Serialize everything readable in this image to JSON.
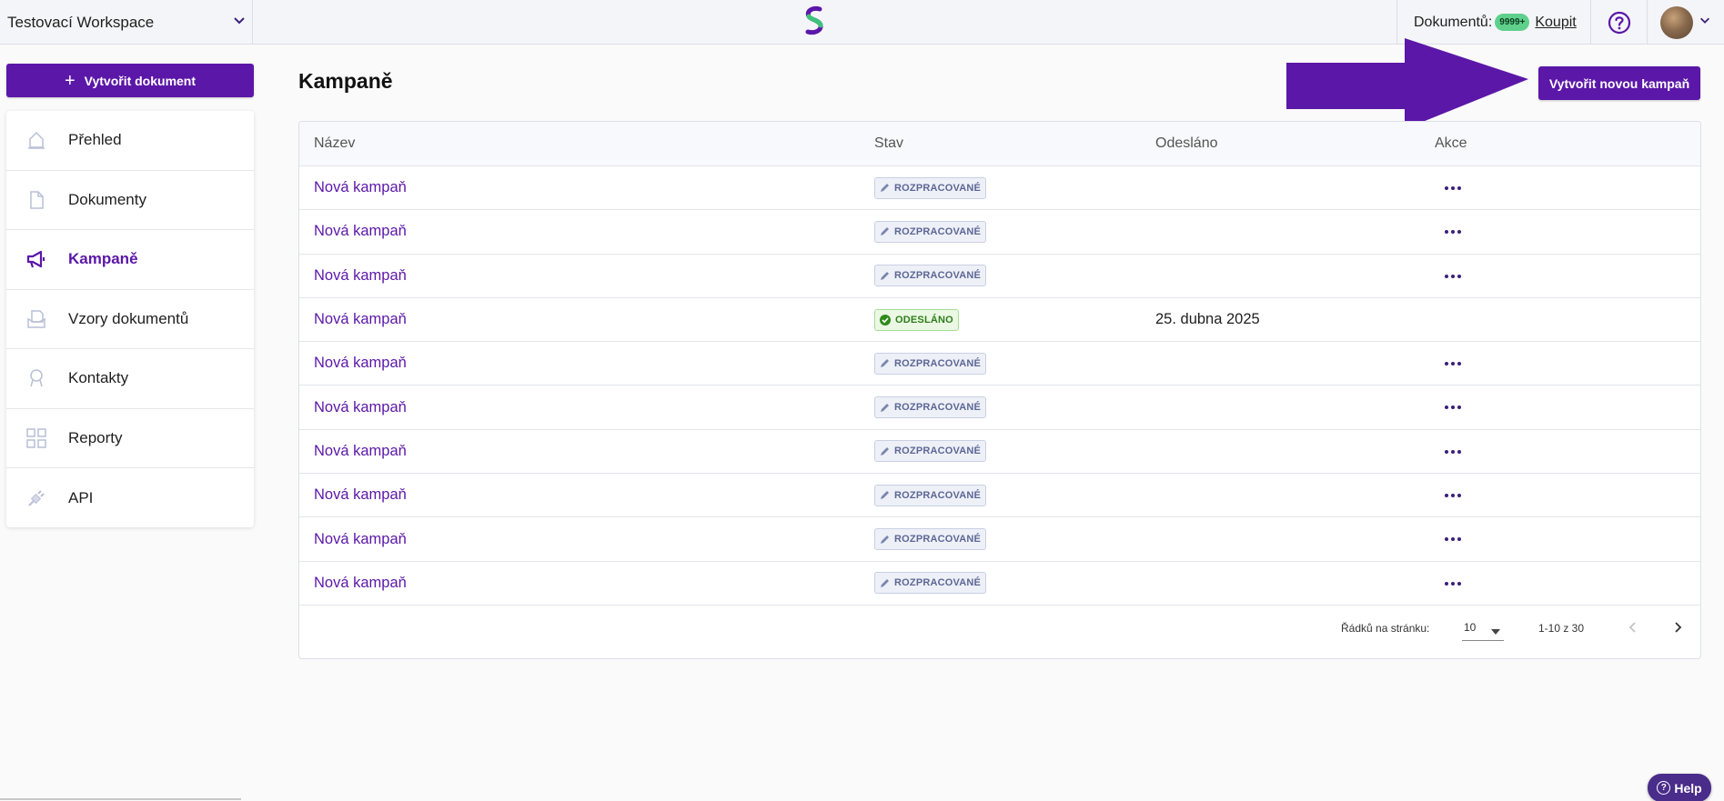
{
  "topbar": {
    "workspace": "Testovací Workspace",
    "docs_label": "Dokumentů:",
    "docs_count": "9999+",
    "buy_label": "Koupit"
  },
  "sidebar": {
    "create_label": "Vytvořit dokument",
    "items": [
      {
        "label": "Přehled",
        "icon": "home-icon"
      },
      {
        "label": "Dokumenty",
        "icon": "document-icon"
      },
      {
        "label": "Kampaně",
        "icon": "megaphone-icon",
        "active": true
      },
      {
        "label": "Vzory dokumentů",
        "icon": "template-icon"
      },
      {
        "label": "Kontakty",
        "icon": "contact-icon"
      },
      {
        "label": "Reporty",
        "icon": "grid-icon"
      },
      {
        "label": "API",
        "icon": "plug-icon"
      }
    ]
  },
  "main": {
    "title": "Kampaně",
    "new_button": "Vytvořit novou kampaň",
    "columns": {
      "name": "Název",
      "status": "Stav",
      "sent": "Odesláno",
      "actions": "Akce"
    },
    "rows": [
      {
        "name": "Nová kampaň",
        "status": "ROZPRACOVANÉ",
        "sent": ""
      },
      {
        "name": "Nová kampaň",
        "status": "ROZPRACOVANÉ",
        "sent": ""
      },
      {
        "name": "Nová kampaň",
        "status": "ROZPRACOVANÉ",
        "sent": ""
      },
      {
        "name": "Nová kampaň",
        "status": "ODESLÁNO",
        "sent": "25. dubna 2025"
      },
      {
        "name": "Nová kampaň",
        "status": "ROZPRACOVANÉ",
        "sent": ""
      },
      {
        "name": "Nová kampaň",
        "status": "ROZPRACOVANÉ",
        "sent": ""
      },
      {
        "name": "Nová kampaň",
        "status": "ROZPRACOVANÉ",
        "sent": ""
      },
      {
        "name": "Nová kampaň",
        "status": "ROZPRACOVANÉ",
        "sent": ""
      },
      {
        "name": "Nová kampaň",
        "status": "ROZPRACOVANÉ",
        "sent": ""
      },
      {
        "name": "Nová kampaň",
        "status": "ROZPRACOVANÉ",
        "sent": ""
      }
    ],
    "pagination": {
      "rows_per_page_label": "Řádků na stránku:",
      "rows_per_page": "10",
      "range": "1-10 z 30"
    }
  },
  "help_button": "Help",
  "colors": {
    "accent": "#5b17a8",
    "draft_bg": "#eef0f8",
    "sent_bg": "#eaf8e4"
  }
}
